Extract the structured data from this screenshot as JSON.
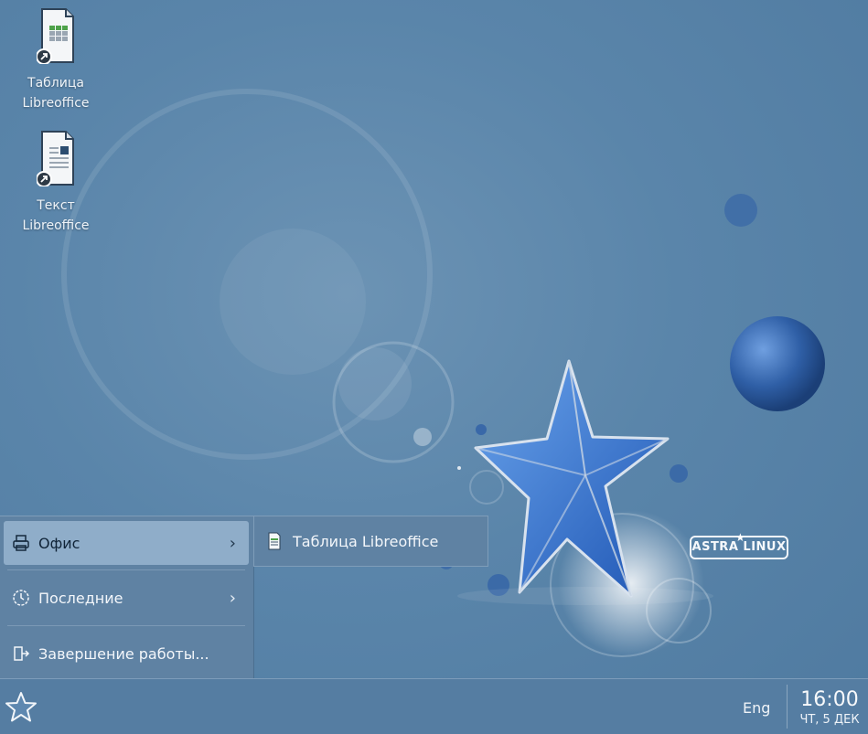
{
  "desktop": {
    "icons": [
      {
        "label_line1": "Таблица",
        "label_line2": "Libreoffice",
        "icon": "spreadsheet-shortcut-icon"
      },
      {
        "label_line1": "Текст",
        "label_line2": "Libreoffice",
        "icon": "text-document-shortcut-icon"
      }
    ],
    "logo_text": "ASTRA LINUX"
  },
  "start_menu": {
    "items": [
      {
        "label": "Офис",
        "icon": "printer-icon",
        "has_submenu": true,
        "active": true
      },
      {
        "label": "Последние",
        "icon": "recent-clock-icon",
        "has_submenu": true,
        "active": false
      },
      {
        "label": "Завершение работы...",
        "icon": "logout-icon",
        "has_submenu": false,
        "active": false
      }
    ],
    "chevron": "›"
  },
  "submenu": {
    "items": [
      {
        "label": "Таблица Libreoffice",
        "icon": "spreadsheet-icon"
      }
    ]
  },
  "taskbar": {
    "language": "Eng",
    "time": "16:00",
    "date": "ЧТ, 5 ДЕК"
  },
  "colors": {
    "desktop_bg": "#5a85aa",
    "menu_bg": "#5f82a3",
    "menu_active": "#8fadc9",
    "taskbar_bg": "#557da2"
  }
}
